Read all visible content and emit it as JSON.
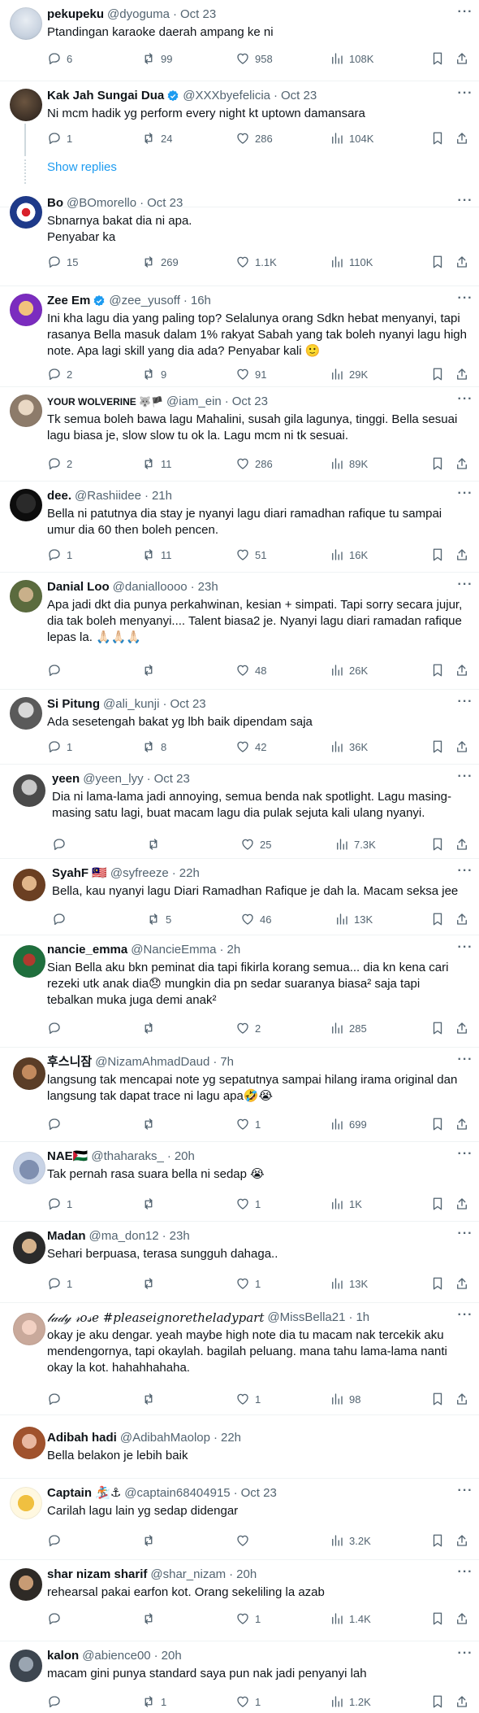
{
  "colors": {
    "accent": "#1d9bf0",
    "secondary": "#536471",
    "text": "#0f1419",
    "border": "#eff3f4"
  },
  "show_replies": "Show replies",
  "tweets": [
    {
      "name": "pekupeku",
      "handle": "@dyoguma",
      "time": "Oct 23",
      "text": "Ptandingan karaoke daerah ampang ke ni",
      "replies": "6",
      "reposts": "99",
      "likes": "958",
      "views": "108K"
    },
    {
      "name": "Kak Jah Sungai Dua",
      "handle": "@XXXbyefelicia",
      "time": "Oct 23",
      "verified": true,
      "text": "Ni mcm hadik yg perform every night kt uptown damansara",
      "replies": "1",
      "reposts": "24",
      "likes": "286",
      "views": "104K"
    },
    {
      "name": "Bo",
      "handle": "@BOmorello",
      "time": "Oct 23",
      "text": "Sbnarnya bakat dia ni apa.\nPenyabar ka",
      "replies": "15",
      "reposts": "269",
      "likes": "1.1K",
      "views": "110K"
    },
    {
      "name": "Zee Em",
      "handle": "@zee_yusoff",
      "time": "16h",
      "verified": true,
      "text": "Ini kha lagu dia yang paling top? Selalunya orang Sdkn hebat menyanyi, tapi rasanya Bella masuk dalam 1% rakyat Sabah yang tak boleh nyanyi lagu high note. Apa lagi skill yang dia ada? Penyabar kali 🙂",
      "replies": "2",
      "reposts": "9",
      "likes": "91",
      "views": "29K"
    },
    {
      "name": "YOUR WOLVERINE 🐺🏴",
      "handle": "@iam_ein",
      "time": "Oct 23",
      "small_name": true,
      "text": "Tk semua boleh bawa lagu Mahalini, susah gila lagunya, tinggi. Bella sesuai lagu biasa je, slow slow tu ok la. Lagu mcm ni tk sesuai.",
      "replies": "2",
      "reposts": "11",
      "likes": "286",
      "views": "89K"
    },
    {
      "name": "dee.",
      "handle": "@Rashiidee",
      "time": "21h",
      "text": "Bella ni patutnya dia stay je nyanyi lagu diari ramadhan rafique tu sampai umur dia 60 then boleh pencen.",
      "replies": "1",
      "reposts": "11",
      "likes": "51",
      "views": "16K"
    },
    {
      "name": "Danial Loo",
      "handle": "@danialloooo",
      "time": "23h",
      "text": "Apa jadi dkt dia punya perkahwinan, kesian + simpati. Tapi sorry secara jujur, dia tak boleh menyanyi.... Talent biasa2 je. Nyanyi lagu diari ramadan rafique lepas la. 🙏🏻🙏🏻🙏🏻",
      "replies": "",
      "reposts": "",
      "likes": "48",
      "views": "26K"
    },
    {
      "name": "Si Pitung",
      "handle": "@ali_kunji",
      "time": "Oct 23",
      "text": "Ada sesetengah bakat yg lbh baik dipendam saja",
      "replies": "1",
      "reposts": "8",
      "likes": "42",
      "views": "36K"
    },
    {
      "name": "yeen",
      "handle": "@yeen_lyy",
      "time": "Oct 23",
      "text": "Dia ni lama-lama jadi annoying, semua benda nak spotlight. Lagu masing-masing satu lagi, buat macam lagu dia pulak sejuta kali ulang nyanyi.",
      "replies": "",
      "reposts": "",
      "likes": "25",
      "views": "7.3K"
    },
    {
      "name": "SyahF 🇲🇾",
      "handle": "@syfreeze",
      "time": "22h",
      "text": "Bella, kau nyanyi lagu Diari Ramadhan Rafique je dah la. Macam seksa jee",
      "replies": "",
      "reposts": "5",
      "likes": "46",
      "views": "13K"
    },
    {
      "name": "nancie_emma",
      "handle": "@NancieEmma",
      "time": "2h",
      "text": "Sian Bella aku bkn peminat dia tapi fikirla korang semua... dia kn kena cari rezeki utk anak dia😞 mungkin dia pn sedar suaranya biasa² saja tapi tebalkan muka juga demi anak²",
      "replies": "",
      "reposts": "",
      "likes": "2",
      "views": "285"
    },
    {
      "name": "후스니잠",
      "handle": "@NizamAhmadDaud",
      "time": "7h",
      "text": "langsung tak mencapai note yg sepatutnya sampai hilang irama original dan langsung tak dapat trace ni lagu apa🤣😭",
      "replies": "",
      "reposts": "",
      "likes": "1",
      "views": "699"
    },
    {
      "name": "NAE🇵🇸",
      "handle": "@thaharaks_",
      "time": "20h",
      "text": "Tak pernah rasa suara bella ni sedap 😭",
      "replies": "1",
      "reposts": "",
      "likes": "1",
      "views": "1K"
    },
    {
      "name": "Madan",
      "handle": "@ma_don12",
      "time": "23h",
      "text": "Sehari berpuasa, terasa sungguh dahaga..",
      "replies": "1",
      "reposts": "",
      "likes": "1",
      "views": "13K"
    },
    {
      "name": "𝓁𝒶𝒹𝓎 𝓇𝑜𝓈𝑒 #pleaseignoretheladypart",
      "handle": "@MissBella21",
      "time": "1h",
      "text": "okay je aku dengar. yeah maybe high note dia tu macam nak tercekik aku mendengornya, tapi okaylah. bagilah peluang. mana tahu lama-lama nanti okay la kot. hahahhahaha.",
      "replies": "",
      "reposts": "",
      "likes": "1",
      "views": "98"
    },
    {
      "name": "Adibah hadi",
      "handle": "@AdibahMaolop",
      "time": "22h",
      "text": "Bella belakon je lebih baik",
      "no_actions": true
    },
    {
      "name": "Captain 🏂⚓",
      "handle": "@captain68404915",
      "time": "Oct 23",
      "text": "Carilah lagu lain yg sedap didengar",
      "replies": "",
      "reposts": "",
      "likes": "",
      "views": "3.2K"
    },
    {
      "name": "shar nizam sharif",
      "handle": "@shar_nizam",
      "time": "20h",
      "text": "rehearsal pakai earfon kot. Orang sekeliling la azab",
      "replies": "",
      "reposts": "",
      "likes": "1",
      "views": "1.4K"
    },
    {
      "name": "kalon",
      "handle": "@abience00",
      "time": "20h",
      "text": "macam gini punya standard saya pun nak jadi penyanyi lah",
      "replies": "",
      "reposts": "1",
      "likes": "1",
      "views": "1.2K"
    }
  ]
}
